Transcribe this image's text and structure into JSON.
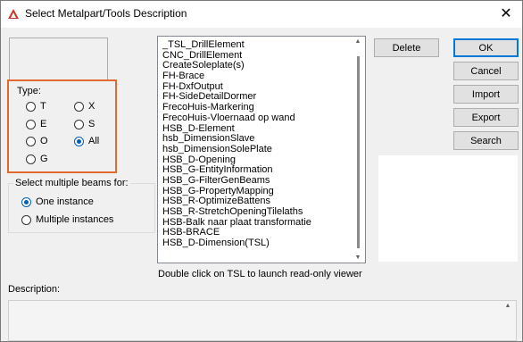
{
  "window": {
    "title": "Select Metalpart/Tools Description",
    "close_glyph": "✕"
  },
  "type_group": {
    "label": "Type:",
    "options": [
      {
        "label": "T",
        "checked": false
      },
      {
        "label": "X",
        "checked": false
      },
      {
        "label": "E",
        "checked": false
      },
      {
        "label": "S",
        "checked": false
      },
      {
        "label": "O",
        "checked": false
      },
      {
        "label": "All",
        "checked": true
      },
      {
        "label": "G",
        "checked": false
      }
    ]
  },
  "beams_group": {
    "label": "Select multiple beams for:",
    "options": [
      {
        "label": "One instance",
        "checked": true
      },
      {
        "label": "Multiple instances",
        "checked": false
      }
    ]
  },
  "tsl_list": {
    "items": [
      "_TSL_DrillElement",
      "CNC_DrillElement",
      "CreateSoleplate(s)",
      "FH-Brace",
      "FH-DxfOutput",
      "FH-SideDetailDormer",
      "FrecoHuis-Markering",
      "FrecoHuis-Vloernaad op wand",
      "HSB_D-Element",
      "hsb_DimensionSlave",
      "hsb_DimensionSolePlate",
      "HSB_D-Opening",
      "HSB_G-EntityInformation",
      "HSB_G-FilterGenBeams",
      "HSB_G-PropertyMapping",
      "HSB_R-OptimizeBattens",
      "HSB_R-StretchOpeningTilelaths",
      "HSB-Balk naar plaat transformatie",
      "HSB-BRACE",
      "HSB_D-Dimension(TSL)"
    ]
  },
  "buttons": {
    "delete": "Delete",
    "ok": "OK",
    "cancel": "Cancel",
    "import": "Import",
    "export": "Export",
    "search": "Search"
  },
  "hint": "Double click on TSL to launch read-only viewer",
  "description": {
    "label": "Description:",
    "value": ""
  },
  "colors": {
    "accent": "#005fb8",
    "highlight_border": "#e06a2f",
    "app_icon": "#c0392b"
  }
}
